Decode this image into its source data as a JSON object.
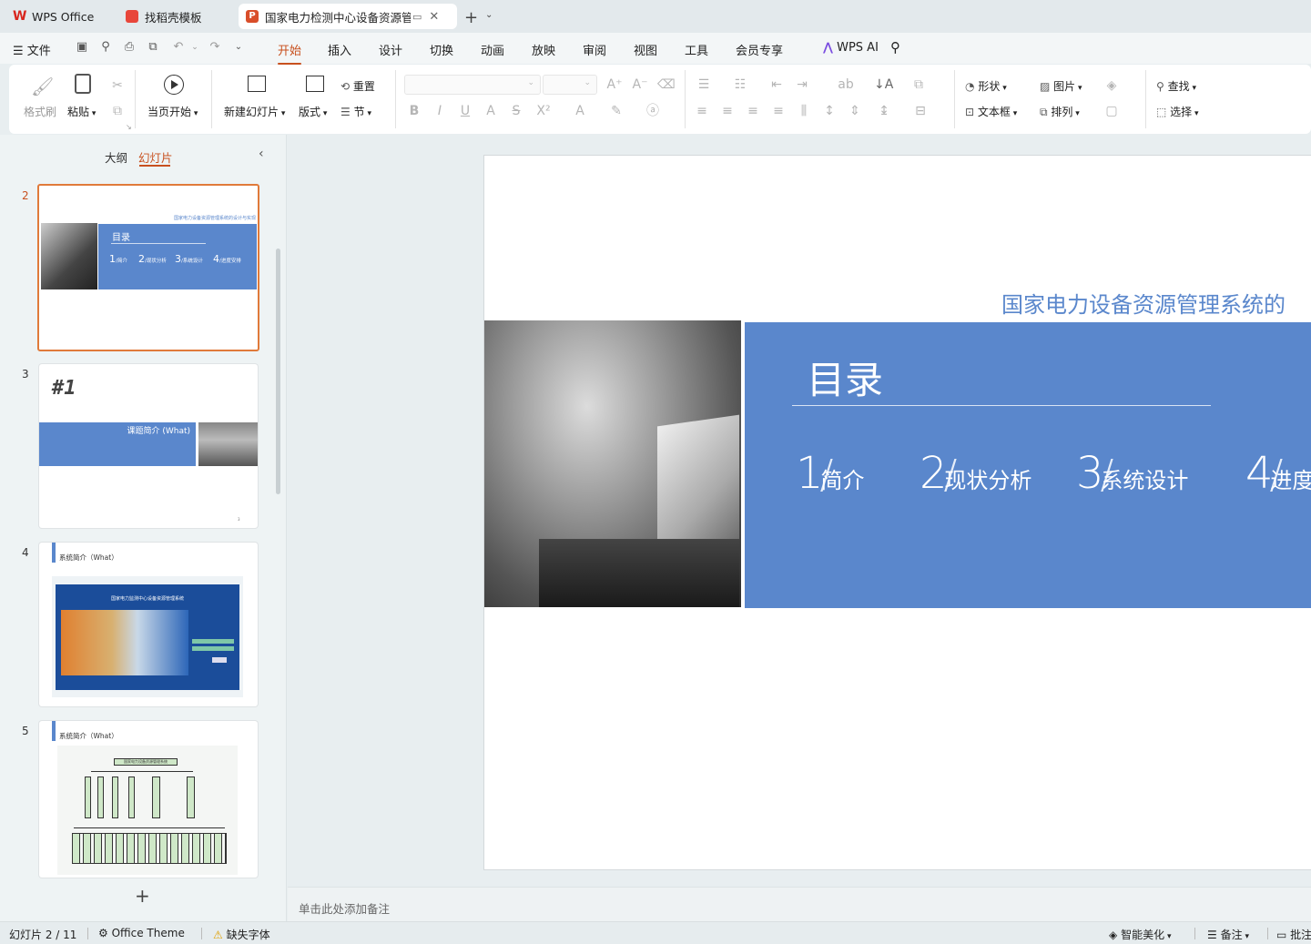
{
  "tabs": [
    {
      "label": "WPS Office",
      "color": "#d8261e"
    },
    {
      "label": "找稻壳模板",
      "color": "#e8463a"
    },
    {
      "label": "国家电力检测中心设备资源管",
      "color": "#d94e2a"
    }
  ],
  "menu": {
    "file": "文件",
    "items": [
      "开始",
      "插入",
      "设计",
      "切换",
      "动画",
      "放映",
      "审阅",
      "视图",
      "工具",
      "会员专享"
    ],
    "active": "开始",
    "wps_ai": "WPS AI"
  },
  "ribbon": {
    "format_painter": "格式刷",
    "paste": "粘贴",
    "start_from_current": "当页开始",
    "new_slide": "新建幻灯片",
    "layout": "版式",
    "reset": "重置",
    "section": "节",
    "shape": "形状",
    "picture": "图片",
    "textbox": "文本框",
    "arrange": "排列",
    "find": "查找",
    "select": "选择"
  },
  "panel": {
    "outline_tab": "大纲",
    "slides_tab": "幻灯片",
    "add_icon": "plus-icon",
    "slides": [
      {
        "num": "2",
        "header": "国家电力设备资源管理系统的设计与实现",
        "title": "目录",
        "items": [
          {
            "n": "1",
            "t": "简介"
          },
          {
            "n": "2",
            "t": "现状分析"
          },
          {
            "n": "3",
            "t": "系统设计"
          },
          {
            "n": "4",
            "t": "进度安排"
          }
        ]
      },
      {
        "num": "3",
        "title": "#1",
        "subtitle": "课题简介 (What)",
        "page": "3"
      },
      {
        "num": "4",
        "label": "系统简介（What）",
        "banner": "国家电力监测中心设备资源管理系统"
      },
      {
        "num": "5",
        "label": "系统简介（What）",
        "root": "国家电力设备资源管理系统"
      }
    ]
  },
  "slide": {
    "header": "国家电力设备资源管理系统的",
    "title": "目录",
    "items": [
      {
        "n": "1",
        "t": "简介"
      },
      {
        "n": "2",
        "t": "现状分析"
      },
      {
        "n": "3",
        "t": "系统设计"
      },
      {
        "n": "4",
        "t": "进度"
      }
    ],
    "accent": "#5a87cc"
  },
  "notes_placeholder": "单击此处添加备注",
  "status": {
    "slide_counter": "幻灯片 2 / 11",
    "theme": "Office Theme",
    "missing_font": "缺失字体",
    "smart_beautify": "智能美化",
    "notes": "备注",
    "comments": "批注"
  }
}
